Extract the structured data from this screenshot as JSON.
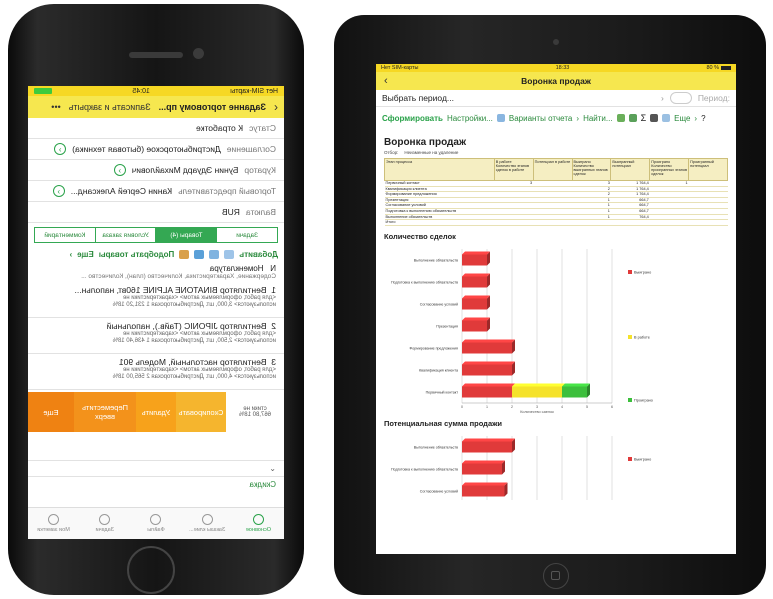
{
  "phone": {
    "status": {
      "time": "10:45",
      "carrier": "Нет SIM-карты"
    },
    "header": {
      "title": "Заданне торговому пр...",
      "action": "Записать и закрыть",
      "more": "•••"
    },
    "rows": [
      {
        "label": "Статус",
        "value": "К отработке",
        "link": false
      },
      {
        "label": "Соглашение",
        "value": "Дистрибьюторское (бытовая техника)",
        "link": true
      },
      {
        "label": "Куратор",
        "value": "Бунин Эдуард Михайлович",
        "link": true
      },
      {
        "label": "Торговый представитель",
        "value": "Канин Сергей Александ...",
        "link": true
      },
      {
        "label": "Валюта",
        "value": "RUB",
        "link": false
      }
    ],
    "tabs": [
      "Задачи",
      "Товары (4)",
      "Условия заказа",
      "Комментарий"
    ],
    "active_tab": 1,
    "toolbar": {
      "add": "Добавить",
      "pick": "Подобрать товары",
      "more": "Еще"
    },
    "columns": {
      "num": "N",
      "title": "Номенклатура",
      "sub": "Содержание, Характеристика, Количество (план), Количество ..."
    },
    "items": [
      {
        "num": "1",
        "name": "Вентилятор BINATONE ALPINE 160вт, напольн...",
        "sub1": "<для работ, оформляемых актом> <характеристики не",
        "sub2": "используются> 3,000, шт. Дистрибьюторская 1 231,20 18%"
      },
      {
        "num": "2",
        "name": "Вентилятор JIPONIC (Тайв.), напольный",
        "sub1": "<для работ, оформляемых актом> <характеристики не",
        "sub2": "используются> 2,500, шт. Дистрибьюторская 1 436,40 18%"
      },
      {
        "num": "3",
        "name": "Вентилятор настольный, Модель 901",
        "sub1": "<для работ, оформляемых актом> <характеристики не",
        "sub2": "используются> 4,000, шт. Дистрибьюторская 2 565,00 18%"
      }
    ],
    "swipe": {
      "copy": "Скопировать",
      "delete": "Удалить",
      "move_up": "Переместить вверх",
      "more": "Еще",
      "partial_value": "667,80",
      "partial_pct": "18%",
      "partial_text": "стики не"
    },
    "lower_label": "Скидка",
    "tabbar": [
      "Основное",
      "Заказы клие...",
      "Файлы",
      "Задачи",
      "Мои заметки"
    ],
    "colors": {
      "accent": "#f6e74f",
      "green": "#34a853",
      "orange": "#f7a21b"
    }
  },
  "tablet": {
    "status": {
      "carrier": "Нет SIM-карты",
      "time": "18:33",
      "battery": "80 %"
    },
    "header": {
      "title": "Воронка продаж"
    },
    "period": {
      "placeholder": "Выбрать период...",
      "label": "Период:"
    },
    "toolbar": {
      "generate": "Сформировать",
      "settings": "Настройки...",
      "variants": "Варианты отчета",
      "find": "Найти...",
      "more": "Еще",
      "help": "?"
    },
    "report": {
      "title": "Воронка продаж",
      "filter_label": "Отбор:",
      "filter_value": "Неизменные на удаление",
      "table": {
        "headers": [
          "Этап процесса",
          "В работе Количество этапов сделок в работе",
          "Потенциал в работе",
          "Выиграно Количество выигранных этапов сделок",
          "Выигранный потенциал",
          "Проиграно Количество проигранных этапов сделок",
          "Проигранный потенциал"
        ],
        "rows": [
          [
            "Первичный контакт",
            "3",
            "",
            "3",
            "1 764,4",
            "1",
            ""
          ],
          [
            "Квалификация клиента",
            "",
            "",
            "2",
            "1 764,4",
            "",
            ""
          ],
          [
            "Формирование предложения",
            "",
            "",
            "2",
            "1 764,4",
            "",
            ""
          ],
          [
            "Презентация",
            "",
            "",
            "1",
            "664,7",
            "",
            ""
          ],
          [
            "Согласование условий",
            "",
            "",
            "1",
            "664,7",
            "",
            ""
          ],
          [
            "Подготовка к выполнению обязательств",
            "",
            "",
            "1",
            "664,7",
            "",
            ""
          ],
          [
            "Выполнение обязательств",
            "",
            "",
            "1",
            "764,4",
            "",
            ""
          ],
          [
            "Итого",
            "",
            "",
            "",
            "",
            "",
            ""
          ]
        ]
      }
    }
  },
  "chart_data": [
    {
      "type": "bar",
      "title": "Количество сделок",
      "orientation": "horizontal",
      "stacked": true,
      "categories": [
        "Выполнение обязательств",
        "Подготовка к выполнению обязательств",
        "Согласование условий",
        "Презентация",
        "Формирование предложения",
        "Квалификация клиента",
        "Первичный контакт"
      ],
      "series": [
        {
          "name": "Выиграно",
          "color": "#e03a3a",
          "values": [
            1,
            1,
            1,
            1,
            2,
            2,
            2
          ]
        },
        {
          "name": "В работе",
          "color": "#f5e22a",
          "values": [
            0,
            0,
            0,
            0,
            0,
            0,
            2
          ]
        },
        {
          "name": "Проиграно",
          "color": "#3cbf3c",
          "values": [
            0,
            0,
            0,
            0,
            0,
            0,
            1
          ]
        }
      ],
      "xlim": [
        0,
        6
      ],
      "x_ticks": [
        "0",
        "1",
        "2",
        "3",
        "4",
        "5",
        "6"
      ],
      "xlabel": "Количество сделок",
      "grid": true,
      "legend": "right"
    },
    {
      "type": "bar",
      "title": "Потенциальная сумма продажи",
      "orientation": "horizontal",
      "categories": [
        "Выполнение обязательств",
        "Подготовка к выполнению обязательств",
        "Согласование условий"
      ],
      "series": [
        {
          "name": "Выиграно",
          "color": "#e03a3a",
          "values": [
            2.0,
            1.6,
            1.7
          ]
        }
      ],
      "xlim": [
        0,
        6
      ],
      "grid": true,
      "legend": "right"
    }
  ]
}
